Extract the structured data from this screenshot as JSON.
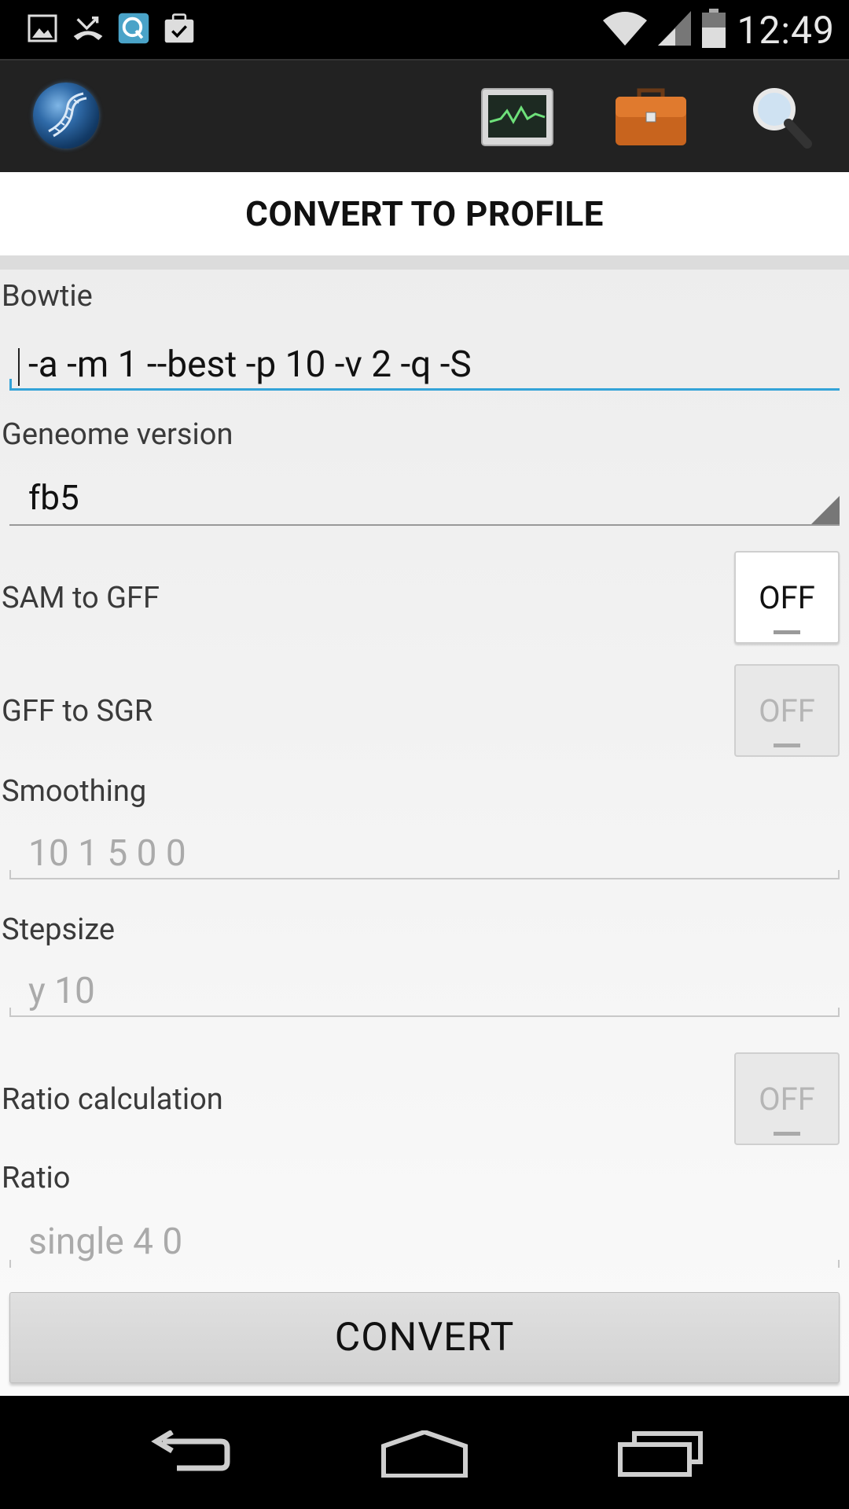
{
  "status_bar": {
    "time": "12:49",
    "left_icons": [
      "image-icon",
      "missed-call-icon",
      "q-app-icon",
      "tasks-icon"
    ],
    "right_icons": [
      "wifi-icon",
      "signal-icon",
      "battery-icon"
    ]
  },
  "action_bar": {
    "logo": "dna-globe-logo",
    "actions": [
      "chart-icon",
      "briefcase-icon",
      "search-icon"
    ]
  },
  "page": {
    "title": "CONVERT TO PROFILE"
  },
  "form": {
    "bowtie": {
      "label": "Bowtie",
      "value": "-a -m 1 --best -p 10 -v 2 -q -S"
    },
    "genome": {
      "label": "Geneome version",
      "selected": "fb5"
    },
    "sam_to_gff": {
      "label": "SAM to GFF",
      "state": "OFF",
      "enabled": true
    },
    "gff_to_sgr": {
      "label": "GFF to SGR",
      "state": "OFF",
      "enabled": false
    },
    "smoothing": {
      "label": "Smoothing",
      "placeholder": "10 1 5 0 0"
    },
    "stepsize": {
      "label": "Stepsize",
      "placeholder": "y 10"
    },
    "ratio_calc": {
      "label": "Ratio calculation",
      "state": "OFF",
      "enabled": false
    },
    "ratio": {
      "label": "Ratio",
      "placeholder": "single 4 0"
    },
    "convert_label": "CONVERT"
  },
  "nav_bar": {
    "buttons": [
      "back-icon",
      "home-icon",
      "recent-apps-icon"
    ]
  }
}
